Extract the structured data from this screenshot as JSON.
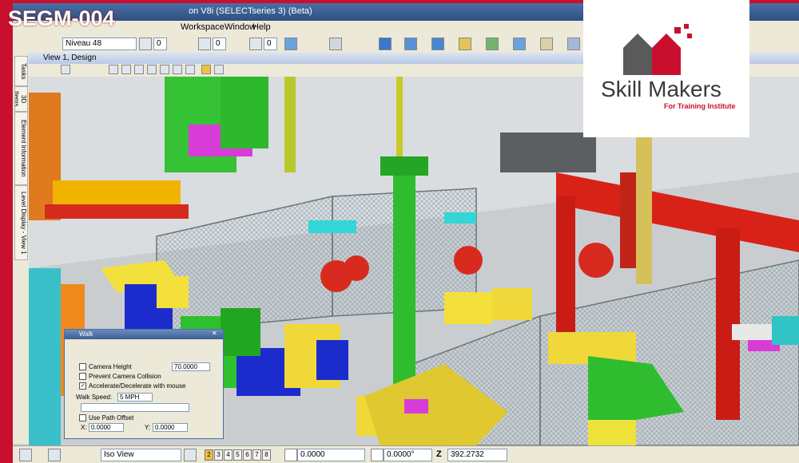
{
  "badge": {
    "code": "SEGM-004"
  },
  "logo": {
    "name": "Skill Makers",
    "tagline": "For Training Institute",
    "brand_color": "#c8102e"
  },
  "app": {
    "title": "on V8i (SELECTseries 3) (Beta)"
  },
  "menu": {
    "items": [
      "Workspace",
      "Window",
      "Help"
    ]
  },
  "toolbar": {
    "level": "Niveau 48",
    "combo_a": "0",
    "combo_b": "0",
    "combo_c": "0"
  },
  "view": {
    "title": "View 1, Design"
  },
  "left_tabs": [
    "Tasks",
    "3D Items",
    "Element Information",
    "Level Display - View 1"
  ],
  "walk": {
    "title": "Walk",
    "camera_height_label": "Camera Height",
    "camera_height_value": "70.0000",
    "prevent_collision_label": "Prevent Camera Collision",
    "accelerate_label": "Accelerate/Decelerate with mouse",
    "walk_speed_label": "Walk Speed:",
    "walk_speed_value": "5 MPH",
    "use_path_offset_label": "Use Path Offset",
    "x_label": "X:",
    "x_value": "0.0000",
    "y_label": "Y:",
    "y_value": "0.0000"
  },
  "status": {
    "view_mode": "Iso View",
    "view_buttons": [
      "2",
      "3",
      "4",
      "5",
      "6",
      "7",
      "8"
    ],
    "x_value": "0.0000",
    "angle_value": "0.0000°",
    "z_label": "Z",
    "z_value": "392.2732"
  }
}
